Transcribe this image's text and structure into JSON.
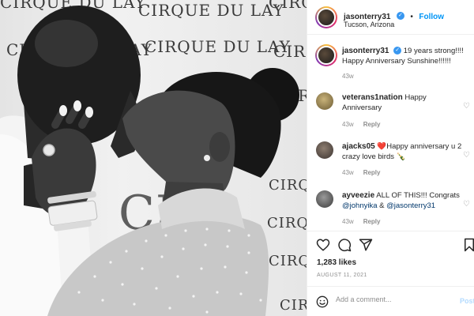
{
  "post": {
    "username": "jasonterry31",
    "follow_label": "Follow",
    "location": "Tucson, Arizona",
    "caption": "19 years strong!!!! Happy Anniversary Sunshine!!!!!!",
    "caption_age": "43w",
    "backdrop_text": "CIRQUE DU LAY",
    "backdrop_text_short": "CIRQ",
    "backdrop_text_letters": "CIRQUE",
    "backdrop_text_fragment": "CE"
  },
  "comments": [
    {
      "user": "veterans1nation",
      "text": "Happy Anniversary",
      "age": "43w",
      "reply": "Reply"
    },
    {
      "user": "ajacks05",
      "emoji": "❤️",
      "text": "Happy anniversary u 2 crazy love birds",
      "emoji2": "🍾",
      "age": "43w",
      "reply": "Reply"
    },
    {
      "user": "ayveezie",
      "text": "ALL OF THIS!!! Congrats",
      "mention1": "@johnyika",
      "amp": "&",
      "mention2": "@jasonterry31",
      "age": "43w",
      "reply": "Reply"
    }
  ],
  "likes": "1,283 likes",
  "date": "AUGUST 11, 2021",
  "add_comment": {
    "placeholder": "Add a comment...",
    "post_label": "Post"
  },
  "icons": {
    "like": "heart-icon",
    "comment": "comment-icon",
    "share": "share-icon",
    "save": "bookmark-icon",
    "emoji": "emoji-icon"
  },
  "colors": {
    "link": "#0095f6",
    "verified": "#3897f0",
    "muted": "#8e8e8e",
    "text": "#262626"
  }
}
